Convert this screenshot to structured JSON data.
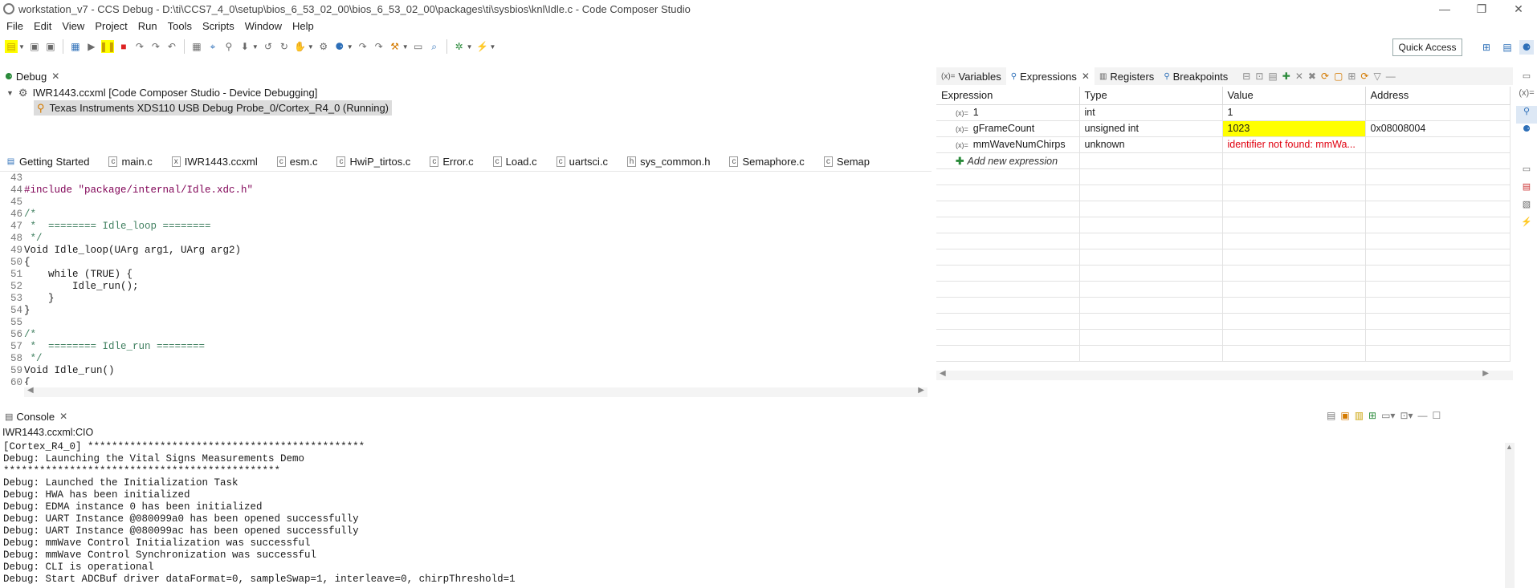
{
  "window": {
    "title": "workstation_v7 - CCS Debug - D:\\ti\\CCS7_4_0\\setup\\bios_6_53_02_00\\bios_6_53_02_00\\packages\\ti\\sysbios\\knl\\Idle.c - Code Composer Studio",
    "minimize": "—",
    "restore": "❐",
    "close": "✕"
  },
  "menu": [
    "File",
    "Edit",
    "View",
    "Project",
    "Run",
    "Tools",
    "Scripts",
    "Window",
    "Help"
  ],
  "toolbar": {
    "quick_access": "Quick Access"
  },
  "debug": {
    "tab_label": "Debug",
    "session": "IWR1443.ccxml [Code Composer Studio - Device Debugging]",
    "thread": "Texas Instruments XDS110 USB Debug Probe_0/Cortex_R4_0 (Running)"
  },
  "editor": {
    "tabs": [
      "Getting Started",
      "main.c",
      "IWR1443.ccxml",
      "esm.c",
      "HwiP_tirtos.c",
      "Error.c",
      "Load.c",
      "uartsci.c",
      "sys_common.h",
      "Semaphore.c",
      "Semap"
    ],
    "lines": [
      {
        "n": "43",
        "t": ""
      },
      {
        "n": "44",
        "t": "#include \"package/internal/Idle.xdc.h\""
      },
      {
        "n": "45",
        "t": ""
      },
      {
        "n": "46",
        "t": "/*"
      },
      {
        "n": "47",
        "t": " *  ======== Idle_loop ========"
      },
      {
        "n": "48",
        "t": " */"
      },
      {
        "n": "49",
        "t": "Void Idle_loop(UArg arg1, UArg arg2)"
      },
      {
        "n": "50",
        "t": "{"
      },
      {
        "n": "51",
        "t": "    while (TRUE) {"
      },
      {
        "n": "52",
        "t": "        Idle_run();"
      },
      {
        "n": "53",
        "t": "    }"
      },
      {
        "n": "54",
        "t": "}"
      },
      {
        "n": "55",
        "t": ""
      },
      {
        "n": "56",
        "t": "/*"
      },
      {
        "n": "57",
        "t": " *  ======== Idle_run ========"
      },
      {
        "n": "58",
        "t": " */"
      },
      {
        "n": "59",
        "t": "Void Idle_run()"
      },
      {
        "n": "60",
        "t": "{"
      }
    ]
  },
  "expressions": {
    "tabs": [
      "Variables",
      "Expressions",
      "Registers",
      "Breakpoints"
    ],
    "columns": [
      "Expression",
      "Type",
      "Value",
      "Address"
    ],
    "rows": [
      {
        "expr": "1",
        "type": "int",
        "value": "1",
        "address": ""
      },
      {
        "expr": "gFrameCount",
        "type": "unsigned int",
        "value": "1023",
        "address": "0x08008004"
      },
      {
        "expr": "mmWaveNumChirps",
        "type": "unknown",
        "value": "identifier not found: mmWa...",
        "address": ""
      }
    ],
    "add_new": "Add new expression"
  },
  "console": {
    "tab_label": "Console",
    "subtitle": "IWR1443.ccxml:CIO",
    "lines": [
      "[Cortex_R4_0] **********************************************",
      "Debug: Launching the Vital Signs Measurements Demo",
      "**********************************************",
      "Debug: Launched the Initialization Task",
      "Debug: HWA has been initialized",
      "Debug: EDMA instance 0 has been initialized",
      "Debug: UART Instance @080099a0 has been opened successfully",
      "Debug: UART Instance @080099ac has been opened successfully",
      "Debug: mmWave Control Initialization was successful",
      "Debug: mmWave Control Synchronization was successful",
      "Debug: CLI is operational",
      "Debug: Start ADCBuf driver dataFormat=0, sampleSwap=1, interleave=0, chirpThreshold=1"
    ]
  }
}
